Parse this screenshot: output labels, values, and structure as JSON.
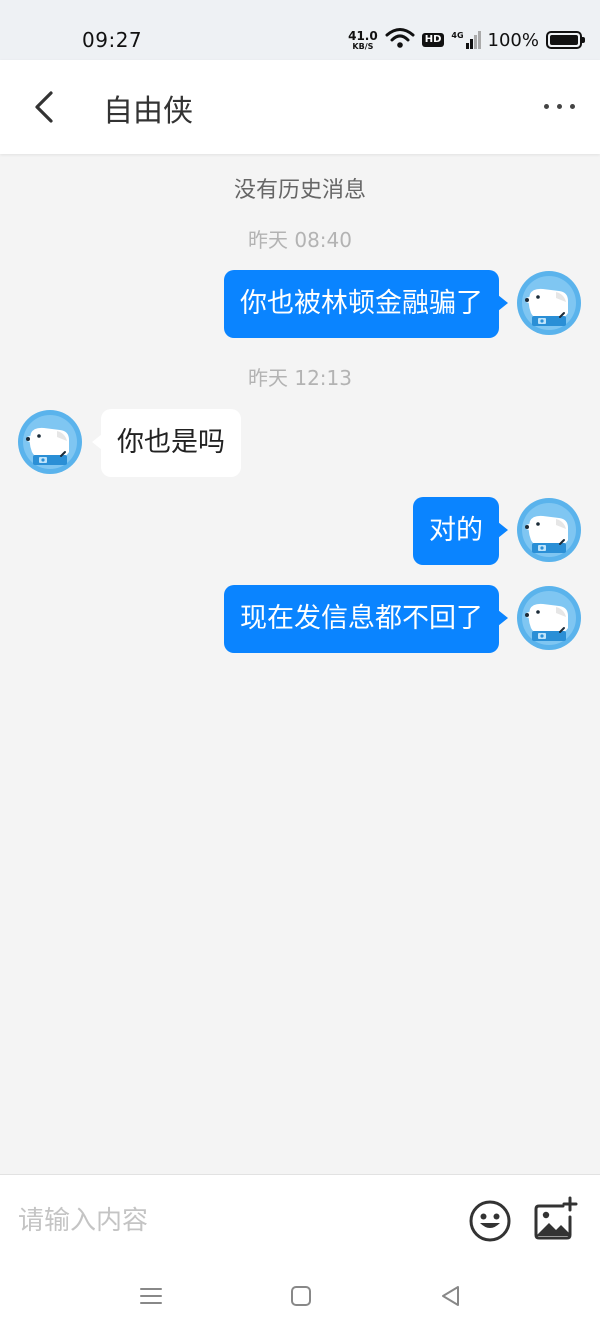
{
  "status_bar": {
    "time": "09:27",
    "net_speed_value": "41.0",
    "net_speed_unit": "KB/S",
    "hd_label": "HD",
    "network_type": "4G",
    "battery_percent": "100%",
    "icons": [
      "wifi-icon",
      "hd-icon",
      "signal-icon",
      "battery-icon"
    ]
  },
  "header": {
    "title": "自由侠",
    "back_icon": "chevron-left-icon",
    "more_icon": "more-horizontal-icon"
  },
  "chat": {
    "no_history_text": "没有历史消息",
    "timestamps": [
      "昨天 08:40",
      "昨天 12:13"
    ],
    "messages": [
      {
        "direction": "outgoing",
        "text": "你也被林顿金融骗了"
      },
      {
        "direction": "incoming",
        "text": "你也是吗"
      },
      {
        "direction": "outgoing",
        "text": "对的"
      },
      {
        "direction": "outgoing",
        "text": "现在发信息都不回了"
      }
    ]
  },
  "input_bar": {
    "placeholder": "请输入内容",
    "value": "",
    "emoji_icon": "smiley-icon",
    "image_icon": "image-add-icon"
  },
  "nav_bar": {
    "icons": [
      "menu-icon",
      "home-square-icon",
      "back-triangle-icon"
    ]
  },
  "colors": {
    "outgoing_bubble": "#0a84ff",
    "incoming_bubble": "#ffffff",
    "chat_background": "#f4f4f4",
    "avatar_blue": "#5ab3ec"
  }
}
